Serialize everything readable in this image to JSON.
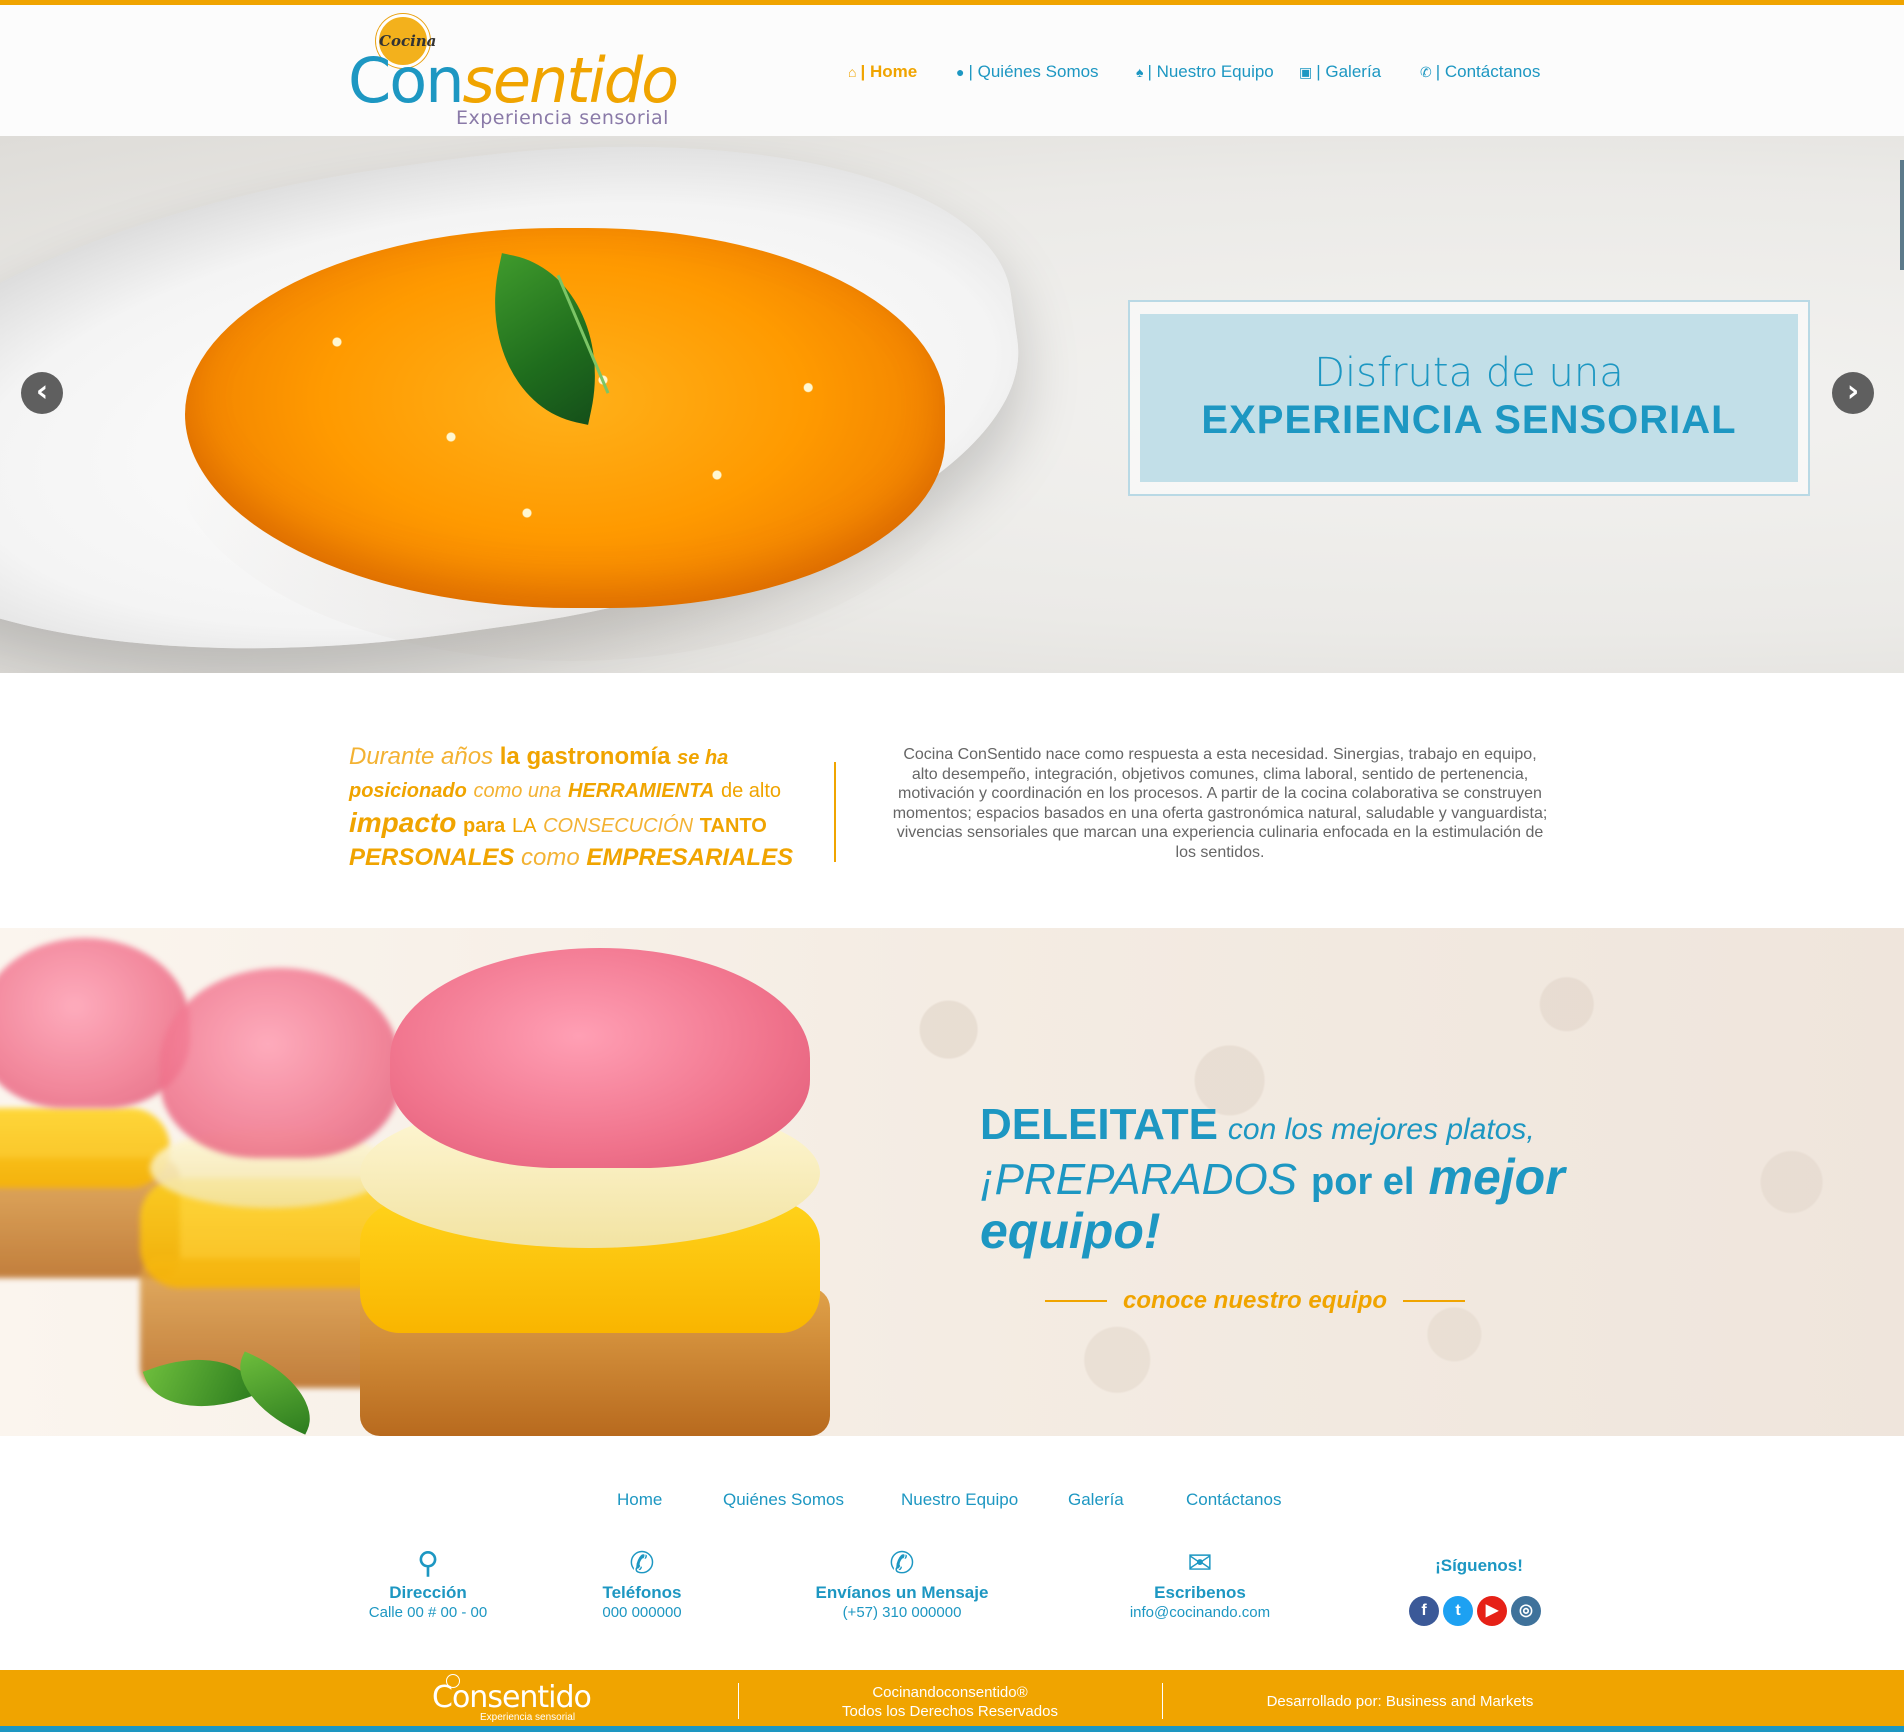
{
  "brand": {
    "badge": "Cocina",
    "word_con": "Con",
    "word_sentido": "sentido",
    "tagline": "Experiencia sensorial"
  },
  "nav": [
    {
      "label": "| Home",
      "icon": "home-icon"
    },
    {
      "label": "| Quiénes Somos",
      "icon": "group-icon"
    },
    {
      "label": "| Nuestro Equipo",
      "icon": "chef-hat-icon"
    },
    {
      "label": "| Galería",
      "icon": "image-icon"
    },
    {
      "label": "| Contáctanos",
      "icon": "phone-icon"
    }
  ],
  "hero": {
    "line1": "Disfruta de una",
    "line2": "EXPERIENCIA SENSORIAL",
    "prev": "‹",
    "next": "›"
  },
  "intro": {
    "p1": "Durante años",
    "p2": "la gastronomía",
    "p3": "se ha",
    "p4": "posicionado",
    "p5": "como una",
    "p6": "HERRAMIENTA",
    "p7": "de alto",
    "p8": "impacto",
    "p9": "para",
    "p10": "LA",
    "p11": "CONSECUCIÓN",
    "p12": "TANTO",
    "p13": "PERSONALES",
    "p14": "como",
    "p15": "EMPRESARIALES",
    "body": "Cocina ConSentido nace como respuesta a esta necesidad. Sinergias, trabajo en equipo, alto desempeño, integración, objetivos comunes, clima laboral, sentido de pertenencia, motivación y coordinación en los procesos. A partir de la cocina colaborativa se construyen momentos; espacios basados en una oferta gastronómica natural, saludable y vanguardista; vivencias sensoriales que marcan una experiencia culinaria enfocada en la estimulación de los sentidos."
  },
  "promo": {
    "w1": "DELEITATE",
    "w2": "con los mejores platos,",
    "w3": "¡PREPARADOS",
    "w4": "por el",
    "w5": "mejor",
    "w6": "equipo!",
    "link": "conoce nuestro equipo"
  },
  "footer": {
    "nav": [
      "Home",
      "Quiénes Somos",
      "Nuestro Equipo",
      "Galería",
      "Contáctanos"
    ],
    "contacts": [
      {
        "icon": "location-pin-icon",
        "title": "Dirección",
        "value": "Calle 00 # 00 - 00"
      },
      {
        "icon": "phone-icon",
        "title": "Teléfonos",
        "value": "000 000000"
      },
      {
        "icon": "whatsapp-icon",
        "title": "Envíanos un Mensaje",
        "value": "(+57) 310 000000"
      },
      {
        "icon": "envelope-icon",
        "title": "Escribenos",
        "value": "info@cocinando.com"
      }
    ],
    "social_title": "¡Síguenos!",
    "social": [
      {
        "icon": "facebook-icon",
        "glyph": "f",
        "color": "#3b5998"
      },
      {
        "icon": "twitter-icon",
        "glyph": "t",
        "color": "#1da1f2"
      },
      {
        "icon": "youtube-icon",
        "glyph": "▶",
        "color": "#e62117"
      },
      {
        "icon": "instagram-icon",
        "glyph": "◎",
        "color": "#3f729b"
      }
    ],
    "bar_logo": "Consentido",
    "bar_logo_sub": "Experiencia sensorial",
    "copyright_1": "Cocinandoconsentido®",
    "copyright_2": "Todos los Derechos Reservados",
    "developer": "Desarrollado por:  Business and Markets"
  },
  "colors": {
    "primary_blue": "#1d97c2",
    "accent_orange": "#f0a400"
  }
}
